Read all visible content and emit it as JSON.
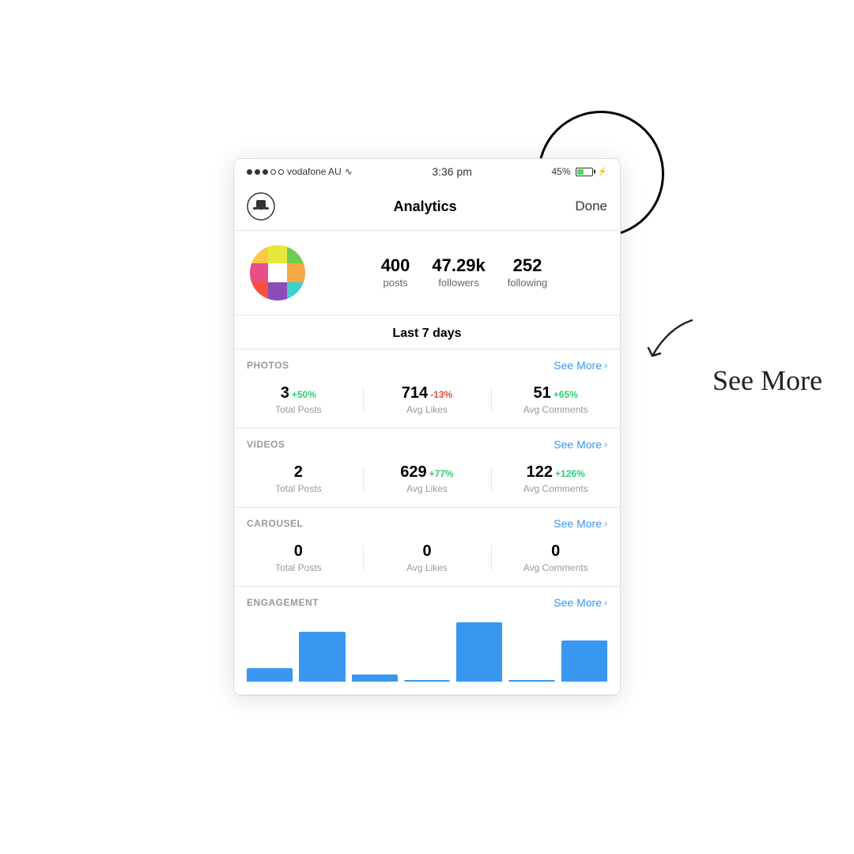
{
  "statusBar": {
    "carrier": "vodafone AU",
    "wifi": "📶",
    "time": "3:36 pm",
    "battery_pct": "45%",
    "dots": [
      "filled",
      "filled",
      "filled",
      "empty",
      "empty"
    ]
  },
  "nav": {
    "title": "Analytics",
    "done": "Done"
  },
  "profile": {
    "posts_value": "400",
    "posts_label": "posts",
    "followers_value": "47.29k",
    "followers_label": "followers",
    "following_value": "252",
    "following_label": "following"
  },
  "period": {
    "label": "Last 7 days"
  },
  "sections": [
    {
      "id": "photos",
      "title": "PHOTOS",
      "see_more": "See More",
      "metrics": [
        {
          "value": "3",
          "change": "+50%",
          "change_type": "positive",
          "label": "Total Posts"
        },
        {
          "value": "714",
          "change": "-13%",
          "change_type": "negative",
          "label": "Avg Likes"
        },
        {
          "value": "51",
          "change": "+65%",
          "change_type": "positive",
          "label": "Avg Comments"
        }
      ]
    },
    {
      "id": "videos",
      "title": "VIDEOS",
      "see_more": "See More",
      "metrics": [
        {
          "value": "2",
          "change": "",
          "change_type": "",
          "label": "Total Posts"
        },
        {
          "value": "629",
          "change": "+77%",
          "change_type": "positive",
          "label": "Avg Likes"
        },
        {
          "value": "122",
          "change": "+126%",
          "change_type": "positive",
          "label": "Avg Comments"
        }
      ]
    },
    {
      "id": "carousel",
      "title": "CAROUSEL",
      "see_more": "See More",
      "metrics": [
        {
          "value": "0",
          "change": "",
          "change_type": "",
          "label": "Total Posts"
        },
        {
          "value": "0",
          "change": "",
          "change_type": "",
          "label": "Avg Likes"
        },
        {
          "value": "0",
          "change": "",
          "change_type": "",
          "label": "Avg Comments"
        }
      ]
    },
    {
      "id": "engagement",
      "title": "ENGAGEMENT",
      "see_more": "See More",
      "chart_bars": [
        15,
        55,
        8,
        0,
        65,
        0,
        45
      ]
    }
  ],
  "annotation": {
    "text": "See More",
    "arrow": "↙"
  },
  "colors": {
    "accent": "#3897f0",
    "positive": "#2ecc71",
    "negative": "#e74c3c"
  },
  "logo_colors": [
    "#f7c948",
    "#e8e83a",
    "#6cce4a",
    "#e94d8a",
    "#fff",
    "#f7a844",
    "#f7503c",
    "#8b4cb8",
    "#3ecfcf"
  ]
}
